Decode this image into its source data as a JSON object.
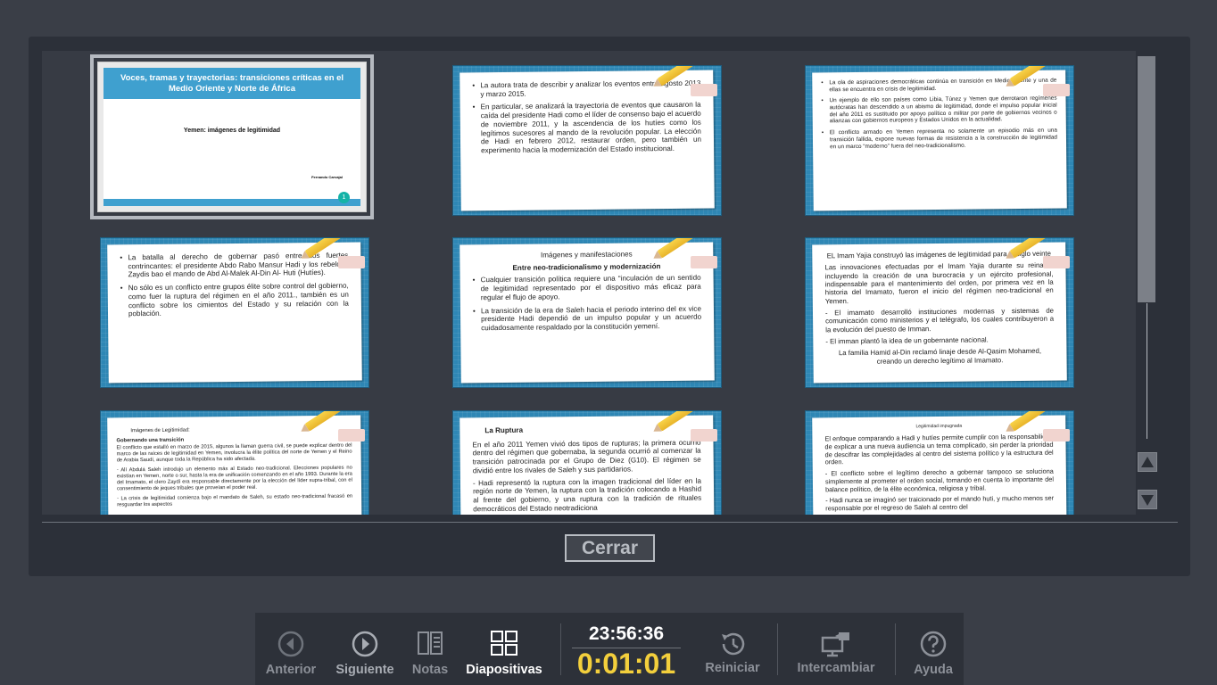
{
  "dialog": {
    "close_label": "Cerrar"
  },
  "slides": [
    {
      "number": "1",
      "title": "Voces, tramas y trayectorias: transiciones críticas en el Medio Oriente y Norte de África",
      "subtitle": "Yemen: imágenes de legitimidad",
      "author": "Fernando Carvajal"
    },
    {
      "bullets": [
        "La autora trata de describir y analizar los eventos entre agosto 2013 y marzo 2015.",
        "En particular, se analizará la trayectoria de eventos que causaron la caída del presidente Hadi como el líder de consenso bajo el acuerdo de noviembre 2011, y la ascendencia de los hutíes como los legítimos sucesores al mando de la revolución popular. La elección de Hadi en febrero 2012, restaurar orden, pero también un experimento hacia la modernización del Estado institucional."
      ]
    },
    {
      "bullets": [
        "La ola de aspiraciones democráticas continúa en transición en Medio Oriente y una de ellas se encuentra en crisis de legitimidad.",
        "Un ejemplo de ello son países como Libia, Túnez y Yemen que derrotaron regímenes autócratas han descendido a un abismo de legitimidad, donde el impulso popular inicial del año 2011 es sustituido por apoyo político o militar por parte de gobiernos vecinos o alianzas con gobiernos europeos y Estados Unidos en la actualidad.",
        "El conflicto armado en Yemen representa no solamente un episodio más en una transición fallida, expone nuevas formas de resistencia a la construcción de legitimidad en un marco “moderno” fuera del neo-tradicionalismo."
      ]
    },
    {
      "bullets": [
        "La batalla al derecho de gobernar pasó entre dos fuertes contrincantes: el presidente Abdo Rabo Mansur Hadi y los rebeldes Zaydis bao el mando de Abd Al-Malek Al-Din Al- Huti (Hutíes).",
        "No sólo es un conflicto entre grupos élite sobre control del gobierno, como fuer la ruptura del régimen en el año 2011., también es un conflicto sobre los cimientos del Estado y su relación con la población."
      ]
    },
    {
      "heading": "Imágenes y manifestaciones",
      "subheading": "Entre neo-tradicionalismo y modernización",
      "bullets": [
        "Cualquier transición política requiere una “inculación de un sentido de legitimidad representado por el dispositivo más eficaz para regular el flujo de apoyo.",
        "La transición de la era de Saleh hacia el periodo interino del ex vice presidente Hadi dependió de un impulso popular y un acuerdo cuidadosamente respaldado por la constitución yemení."
      ]
    },
    {
      "heading": "EL Imam Yajia construyó las imágenes de legitimidad para el siglo veinte",
      "paragraphs": [
        "Las innovaciones efectuadas por el Imam Yajia durante su reinado, incluyendo la creación de una burocracia y un ejército profesional, indispensable para el mantenimiento del orden, por primera vez en la historia del Imamato, fueron el inicio del régimen neo-tradicional en Yemen.",
        "- El imamato desarrolló instituciones modernas y sistemas de comunicación como ministerios y el telégrafo, los cuales contribuyeron a la evolución del puesto de Imman.",
        "- El imman plantó la idea de un gobernante nacional."
      ],
      "indent": "La familia Hamid al-Din reclamó linaje desde Al-Qasim Mohamed, creando un derecho legítimo al Imamato."
    },
    {
      "heading": "Imágenes de Legitimidad:",
      "subheading": "Gobernando una transición",
      "paragraphs": [
        "El conflicto que estalló en marzo de 2015, algunos la llaman guerra civil, se puede explicar dentro del marco de las raíces de legitimidad en Yemen, involucra la élite política del norte de Yemen y el Reino de Arabia Saudí, aunque toda la República ha sido afectada.",
        "- Alí Abdulá Saleh introdujo un elemento más al Estado neo-tradicional. Elecciones populares no existían en Yemen, norte o sur, hasta la era de unificación comenzando en el año 1993. Durante la era del Imamato, el clero Zaydí era responsable directamente por la elección del líder supra-tribal, con el consentimiento de jeques tribales que proveían el poder real.",
        "- La crisis de legitimidad comienza bajo el mandato de Saleh, su estado neo-tradicional fracasó en resguardar los aspectos"
      ]
    },
    {
      "heading": "La Ruptura",
      "paragraphs": [
        "En el año 2011 Yemen vivió dos tipos de rupturas; la primera ocurrió dentro del régimen que gobernaba, la segunda ocurrió al comenzar la transición patrocinada por el Grupo de Diez (G10). El régimen se dividió entre los rivales de Saleh y sus partidarios.",
        "- Hadi representó la ruptura con la imagen tradicional del líder en la región norte de Yemen, la ruptura con la tradición colocando a Hashid al frente del gobierno, y una ruptura con la tradición de rituales democráticos del Estado neotradiciona"
      ]
    },
    {
      "heading": "Legitimidad impugnada",
      "paragraphs": [
        "El enfoque comparando a Hadi y hutíes permite cumplir con la responsabilidad de explicar a una nueva audiencia un tema complicado, sin perder la prioridad de descifrar las complejidades al centro del sistema político y la estructura del orden.",
        "- El conflicto sobre el legítimo derecho a gobernar tampoco se soluciona simplemente al prometer el orden social, tomando en cuenta lo importante del balance político, de la élite económica, religiosa y tribal.",
        "- Hadi nunca se imaginó ser traicionado por el mando huti, y mucho menos ser responsable por el regreso de Saleh al centro del"
      ]
    }
  ],
  "toolbar": {
    "prev_label": "Anterior",
    "next_label": "Siguiente",
    "notes_label": "Notas",
    "slides_label": "Diapositivas",
    "clock_time": "23:56:36",
    "elapsed_time": "0:01:01",
    "restart_label": "Reiniciar",
    "swap_label": "Intercambiar",
    "help_label": "Ayuda"
  },
  "colors": {
    "background": "#3a3e47",
    "panel": "#2c3039",
    "slide_blue": "#2e87b5",
    "elapsed_yellow": "#f3cf3c"
  },
  "icons": {
    "prev": "circle-left-arrow-icon",
    "next": "circle-right-arrow-icon",
    "notes": "notes-icon",
    "slides": "grid-icon",
    "restart": "clock-restart-icon",
    "swap": "monitor-swap-icon",
    "help": "question-circle-icon"
  }
}
